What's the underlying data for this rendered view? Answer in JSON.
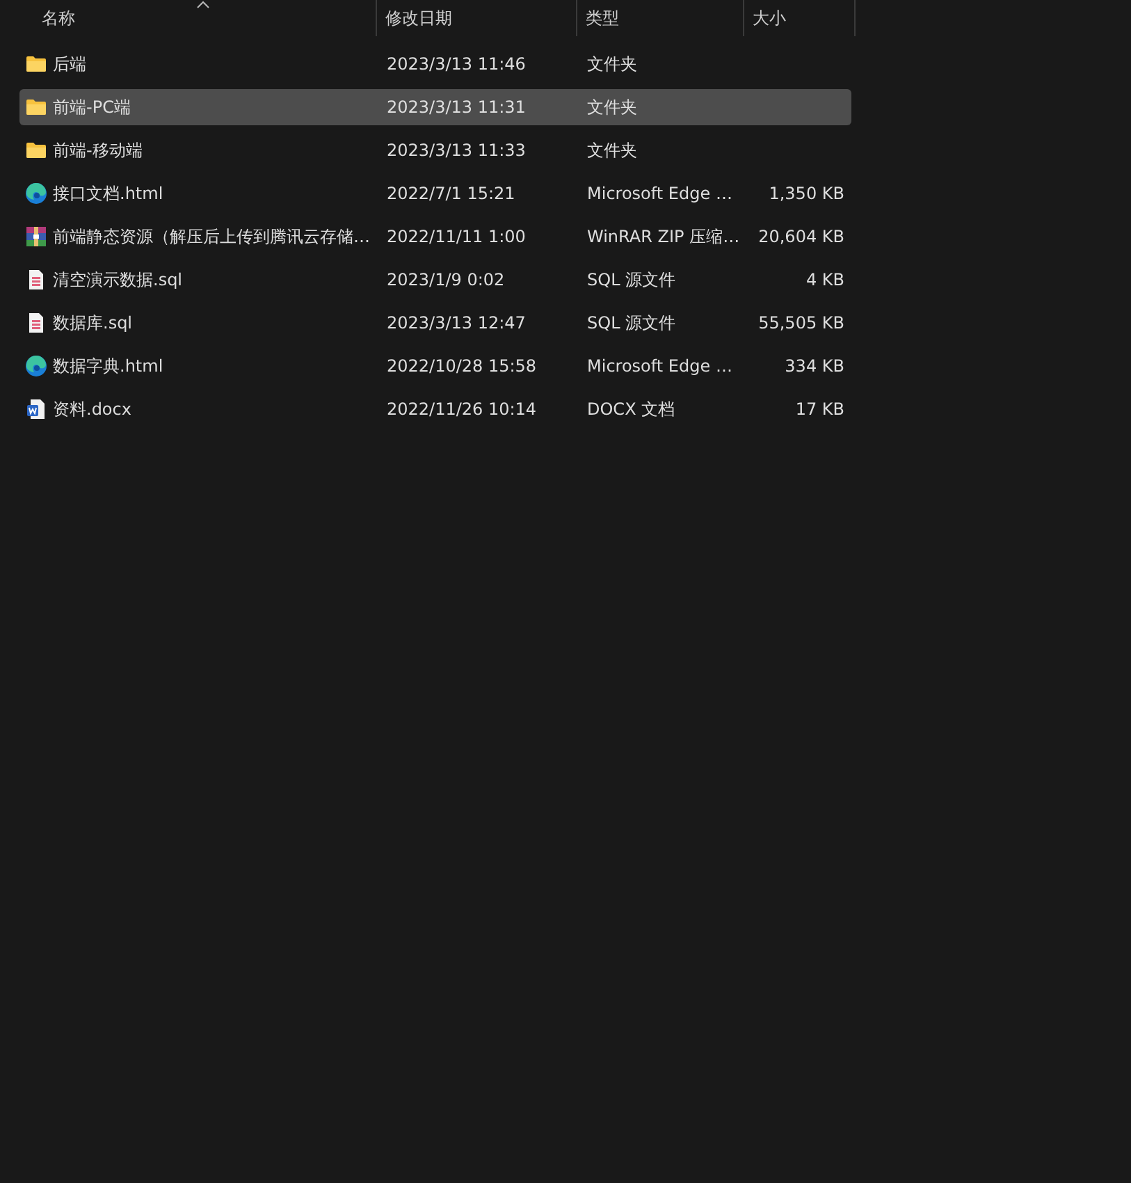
{
  "columns": [
    {
      "label": "名称",
      "sorted": true
    },
    {
      "label": "修改日期",
      "sorted": false
    },
    {
      "label": "类型",
      "sorted": false
    },
    {
      "label": "大小",
      "sorted": false
    }
  ],
  "files": [
    {
      "kind": "folder",
      "name": "后端",
      "modified": "2023/3/13 11:46",
      "type": "文件夹",
      "selected": false
    },
    {
      "kind": "folder",
      "name": "前端-PC端",
      "modified": "2023/3/13 11:31",
      "type": "文件夹",
      "selected": true
    },
    {
      "kind": "folder",
      "name": "前端-移动端",
      "modified": "2023/3/13 11:33",
      "type": "文件夹",
      "selected": false
    },
    {
      "kind": "edge",
      "name": "接口文档.html",
      "modified": "2022/7/1 15:21",
      "type": "Microsoft Edge …",
      "size": "1,350 KB",
      "selected": false
    },
    {
      "kind": "winrar",
      "name": "前端静态资源（解压后上传到腾讯云存储…",
      "modified": "2022/11/11 1:00",
      "type": "WinRAR ZIP 压缩…",
      "size": "20,604 KB",
      "selected": false
    },
    {
      "kind": "sql",
      "name": "清空演示数据.sql",
      "modified": "2023/1/9 0:02",
      "type": "SQL 源文件",
      "size": "4 KB",
      "selected": false
    },
    {
      "kind": "sql",
      "name": "数据库.sql",
      "modified": "2023/3/13 12:47",
      "type": "SQL 源文件",
      "size": "55,505 KB",
      "selected": false
    },
    {
      "kind": "edge",
      "name": "数据字典.html",
      "modified": "2022/10/28 15:58",
      "type": "Microsoft Edge …",
      "size": "334 KB",
      "selected": false
    },
    {
      "kind": "docx",
      "name": "资料.docx",
      "modified": "2022/11/26 10:14",
      "type": "DOCX 文档",
      "size": "17 KB",
      "selected": false
    }
  ]
}
